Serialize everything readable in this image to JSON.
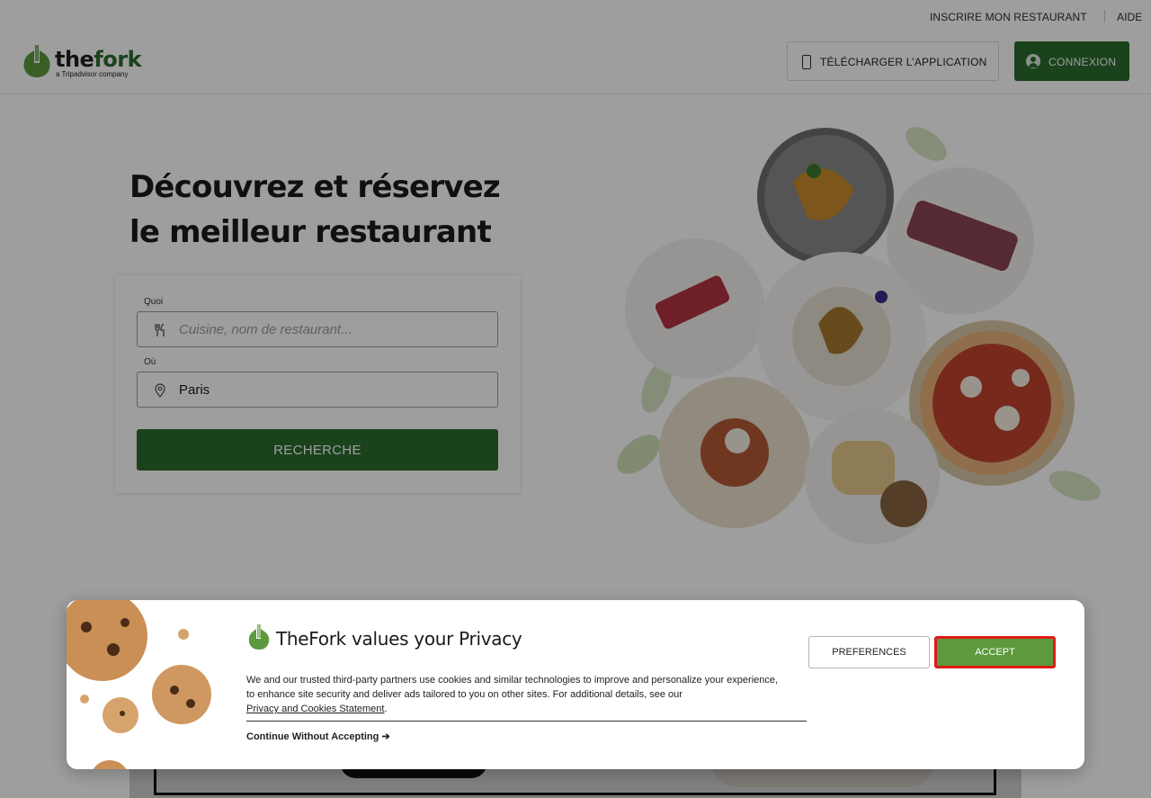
{
  "topbar": {
    "register_restaurant": "INSCRIRE MON RESTAURANT",
    "help": "AIDE"
  },
  "header": {
    "logo_text_the": "the",
    "logo_text_fork": "fork",
    "logo_subtitle": "a Tripadvisor company",
    "download_app": "TÉLÉCHARGER L’APPLICATION",
    "login": "CONNEXION"
  },
  "hero": {
    "title": "Découvrez et réservez le meilleur restaurant"
  },
  "search": {
    "what_label": "Quoi",
    "what_placeholder": "Cuisine, nom de restaurant...",
    "what_value": "",
    "where_label": "Où",
    "where_value": "Paris",
    "submit": "RECHERCHE"
  },
  "cookie_modal": {
    "title": "TheFork values your Privacy",
    "body": "We and our trusted third-party partners use cookies and similar technologies to improve and personalize your experience, to enhance site security and deliver ads tailored to you on other sites. For additional details, see our",
    "link": "Privacy and Cookies Statement",
    "body_end": ".",
    "continue": "Continue Without Accepting",
    "preferences": "PREFERENCES",
    "accept": "ACCEPT"
  },
  "colors": {
    "brand_green": "#2a6b2d",
    "accept_green": "#5c9a3d",
    "highlight_red": "#e01a1a"
  },
  "icons": [
    "phone-icon",
    "user-icon",
    "cutlery-icon",
    "location-pin-icon",
    "arrow-right-icon"
  ]
}
